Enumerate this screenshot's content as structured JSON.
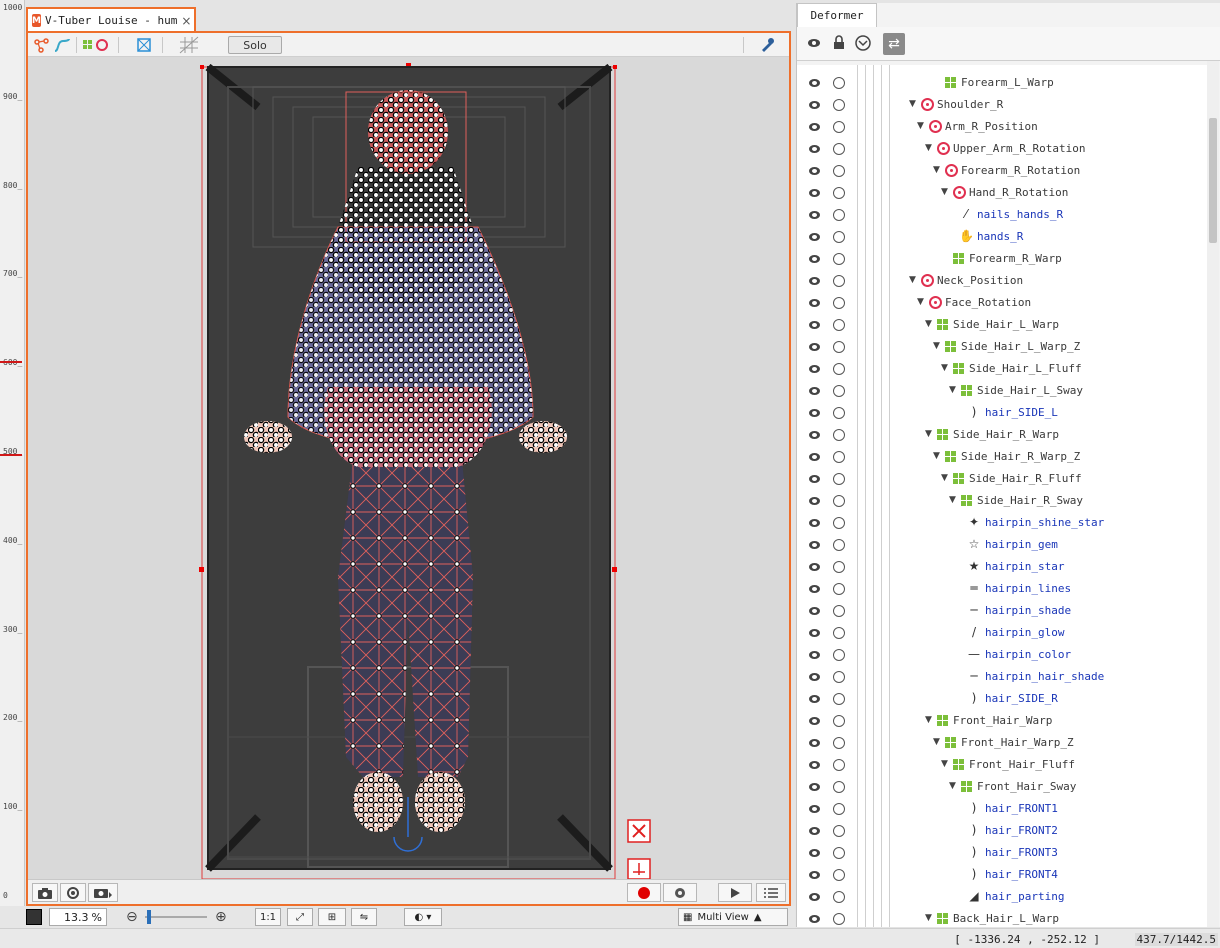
{
  "document_tab": {
    "badge": "M",
    "title": "V-Tuber Louise - hum",
    "close": "×"
  },
  "view_toolbar": {
    "solo_label": "Solo"
  },
  "ruler_ticks": [
    {
      "label": "1000",
      "value": 1000
    },
    {
      "label": "900_",
      "value": 900
    },
    {
      "label": "800_",
      "value": 800
    },
    {
      "label": "700_",
      "value": 700
    },
    {
      "label": "600_",
      "value": 600
    },
    {
      "label": "500_",
      "value": 500
    },
    {
      "label": "400_",
      "value": 400
    },
    {
      "label": "300_",
      "value": 300
    },
    {
      "label": "200_",
      "value": 200
    },
    {
      "label": "100_",
      "value": 100
    },
    {
      "label": "0",
      "value": 0
    }
  ],
  "status_bar": {
    "zoom_value": "13.3",
    "zoom_unit": "%",
    "one_to_one": "1:1",
    "multi_view_label": "Multi View"
  },
  "footer": {
    "coordinates": "[ -1336.24 , -252.12 ]",
    "readout": "437.7/1442.5"
  },
  "deformer_panel": {
    "tab_label": "Deformer",
    "rows": [
      {
        "label": "Forearm_L_Warp",
        "type": "warp",
        "depth": 3,
        "arrow": false
      },
      {
        "label": "Shoulder_R",
        "type": "rotation",
        "depth": 0,
        "arrow": true
      },
      {
        "label": "Arm_R_Position",
        "type": "rotation",
        "depth": 1,
        "arrow": true
      },
      {
        "label": "Upper_Arm_R_Rotation",
        "type": "rotation",
        "depth": 2,
        "arrow": true
      },
      {
        "label": "Forearm_R_Rotation",
        "type": "rotation",
        "depth": 3,
        "arrow": true
      },
      {
        "label": "Hand_R_Rotation",
        "type": "rotation",
        "depth": 4,
        "arrow": true
      },
      {
        "label": "nails_hands_R",
        "type": "artmesh",
        "depth": 5,
        "arrow": false,
        "icon": "nail-icon"
      },
      {
        "label": "hands_R",
        "type": "artmesh",
        "depth": 5,
        "arrow": false,
        "icon": "hand-icon"
      },
      {
        "label": "Forearm_R_Warp",
        "type": "warp",
        "depth": 4,
        "arrow": false
      },
      {
        "label": "Neck_Position",
        "type": "rotation",
        "depth": 0,
        "arrow": true
      },
      {
        "label": "Face_Rotation",
        "type": "rotation",
        "depth": 1,
        "arrow": true
      },
      {
        "label": "Side_Hair_L_Warp",
        "type": "warp",
        "depth": 2,
        "arrow": true
      },
      {
        "label": "Side_Hair_L_Warp_Z",
        "type": "warp",
        "depth": 3,
        "arrow": true
      },
      {
        "label": "Side_Hair_L_Fluff",
        "type": "warp",
        "depth": 4,
        "arrow": true
      },
      {
        "label": "Side_Hair_L_Sway",
        "type": "warp",
        "depth": 5,
        "arrow": true
      },
      {
        "label": "hair_SIDE_L",
        "type": "artmesh",
        "depth": 6,
        "arrow": false,
        "icon": "hair-strand-icon"
      },
      {
        "label": "Side_Hair_R_Warp",
        "type": "warp",
        "depth": 2,
        "arrow": true
      },
      {
        "label": "Side_Hair_R_Warp_Z",
        "type": "warp",
        "depth": 3,
        "arrow": true
      },
      {
        "label": "Side_Hair_R_Fluff",
        "type": "warp",
        "depth": 4,
        "arrow": true
      },
      {
        "label": "Side_Hair_R_Sway",
        "type": "warp",
        "depth": 5,
        "arrow": true
      },
      {
        "label": "hairpin_shine_star",
        "type": "artmesh",
        "depth": 6,
        "arrow": false,
        "icon": "sparkle-icon"
      },
      {
        "label": "hairpin_gem",
        "type": "artmesh",
        "depth": 6,
        "arrow": false,
        "icon": "star-outline-icon"
      },
      {
        "label": "hairpin_star",
        "type": "artmesh",
        "depth": 6,
        "arrow": false,
        "icon": "star-icon"
      },
      {
        "label": "hairpin_lines",
        "type": "artmesh",
        "depth": 6,
        "arrow": false,
        "icon": "lines-icon"
      },
      {
        "label": "hairpin_shade",
        "type": "artmesh",
        "depth": 6,
        "arrow": false,
        "icon": "shade-icon"
      },
      {
        "label": "hairpin_glow",
        "type": "artmesh",
        "depth": 6,
        "arrow": false,
        "icon": "glow-icon"
      },
      {
        "label": "hairpin_color",
        "type": "artmesh",
        "depth": 6,
        "arrow": false,
        "icon": "color-line-icon"
      },
      {
        "label": "hairpin_hair_shade",
        "type": "artmesh",
        "depth": 6,
        "arrow": false,
        "icon": "hair-shade-icon"
      },
      {
        "label": "hair_SIDE_R",
        "type": "artmesh",
        "depth": 6,
        "arrow": false,
        "icon": "hair-strand-icon"
      },
      {
        "label": "Front_Hair_Warp",
        "type": "warp",
        "depth": 2,
        "arrow": true
      },
      {
        "label": "Front_Hair_Warp_Z",
        "type": "warp",
        "depth": 3,
        "arrow": true
      },
      {
        "label": "Front_Hair_Fluff",
        "type": "warp",
        "depth": 4,
        "arrow": true
      },
      {
        "label": "Front_Hair_Sway",
        "type": "warp",
        "depth": 5,
        "arrow": true
      },
      {
        "label": "hair_FRONT1",
        "type": "artmesh",
        "depth": 6,
        "arrow": false,
        "icon": "hair-strand-icon"
      },
      {
        "label": "hair_FRONT2",
        "type": "artmesh",
        "depth": 6,
        "arrow": false,
        "icon": "hair-strand-icon"
      },
      {
        "label": "hair_FRONT3",
        "type": "artmesh",
        "depth": 6,
        "arrow": false,
        "icon": "hair-strand-icon"
      },
      {
        "label": "hair_FRONT4",
        "type": "artmesh",
        "depth": 6,
        "arrow": false,
        "icon": "hair-strand-icon"
      },
      {
        "label": "hair_parting",
        "type": "artmesh",
        "depth": 6,
        "arrow": false,
        "icon": "hair-part-icon"
      },
      {
        "label": "Back_Hair_L_Warp",
        "type": "warp",
        "depth": 2,
        "arrow": true
      }
    ]
  },
  "colors": {
    "accent_orange": "#ee6f2b",
    "rotation_red": "#e03050",
    "warp_green": "#7cbf3a",
    "artmesh_blue": "#1a36b8",
    "record_red": "#e00000"
  }
}
